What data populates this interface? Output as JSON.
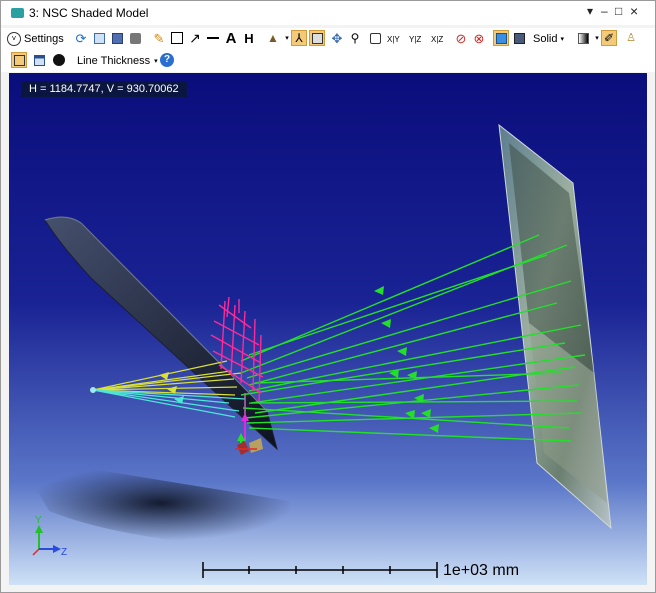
{
  "window": {
    "title": "3: NSC Shaded Model",
    "controls": [
      "▾",
      "–",
      "□",
      "×"
    ]
  },
  "toolbar1": {
    "settings_label": "Settings",
    "solid_label": "Solid",
    "axis_labels": [
      "X|Y",
      "Y|Z",
      "X|Z"
    ]
  },
  "toolbar2": {
    "line_thickness_label": "Line Thickness",
    "help_glyph": "?"
  },
  "viewport": {
    "coordinate_readout": "H = 1184.7747, V = 930.70062",
    "scale_bar_label": "1e+03 mm",
    "axis_y_label": "Y",
    "axis_z_label": "Z"
  },
  "colors": {
    "ray_green": "#22e02a",
    "ray_yellow": "#d8e03a",
    "ray_cyan": "#4fe6d8",
    "detector_magenta": "#ff2a9a",
    "background_top": "#0a0d7c",
    "background_bottom": "#cfe2f7",
    "selected_button": "#f3c97a"
  },
  "icons": [
    "settings-chevron-icon",
    "refresh-icon",
    "copy-icon",
    "save-icon",
    "print-icon",
    "pencil-icon",
    "rectangle-icon",
    "arrow-icon",
    "line-icon",
    "text-icon",
    "dimension-icon",
    "cutaway-icon",
    "axes-icon",
    "zoom-rectangle-icon",
    "pan-icon",
    "zoom-icon",
    "reset-view-icon",
    "clear-icon",
    "stop-icon",
    "cube-icon",
    "stop-square-icon",
    "gradient-icon",
    "pin-icon",
    "lock-icon",
    "fit-icon",
    "window-icon",
    "power-icon",
    "help-icon"
  ]
}
